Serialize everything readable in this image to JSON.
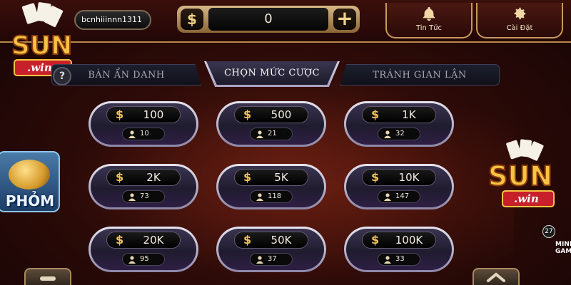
{
  "header": {
    "username": "bcnhiiinnn1311",
    "balance": "0",
    "balance_icon": "dollar-icon",
    "add_icon": "plus-icon",
    "news_label": "Tin Tức",
    "news_icon": "bell-icon",
    "settings_label": "Cài Đặt",
    "settings_icon": "gear-icon"
  },
  "tabs": [
    {
      "label": "BÀN ẨN DANH"
    },
    {
      "label": "CHỌN MỨC CƯỢC",
      "active": true
    },
    {
      "label": "TRÁNH GIAN LẬN"
    }
  ],
  "help_label": "?",
  "bets": [
    {
      "amount": "100",
      "players": "10"
    },
    {
      "amount": "500",
      "players": "21"
    },
    {
      "amount": "1K",
      "players": "32"
    },
    {
      "amount": "2K",
      "players": "73"
    },
    {
      "amount": "5K",
      "players": "118"
    },
    {
      "amount": "10K",
      "players": "147"
    },
    {
      "amount": "20K",
      "players": "95"
    },
    {
      "amount": "50K",
      "players": "37"
    },
    {
      "amount": "100K",
      "players": "33"
    }
  ],
  "bet_currency_symbol": "$",
  "promo": {
    "label": "PHỎM"
  },
  "logo": {
    "brand": "SUN",
    "sub": ".win"
  },
  "mini_game": {
    "count": "27",
    "label": "MINI GAME"
  },
  "colors": {
    "accent_gold": "#c7995a",
    "coin": "#f0c25a",
    "bg_dark": "#2e0b08"
  }
}
